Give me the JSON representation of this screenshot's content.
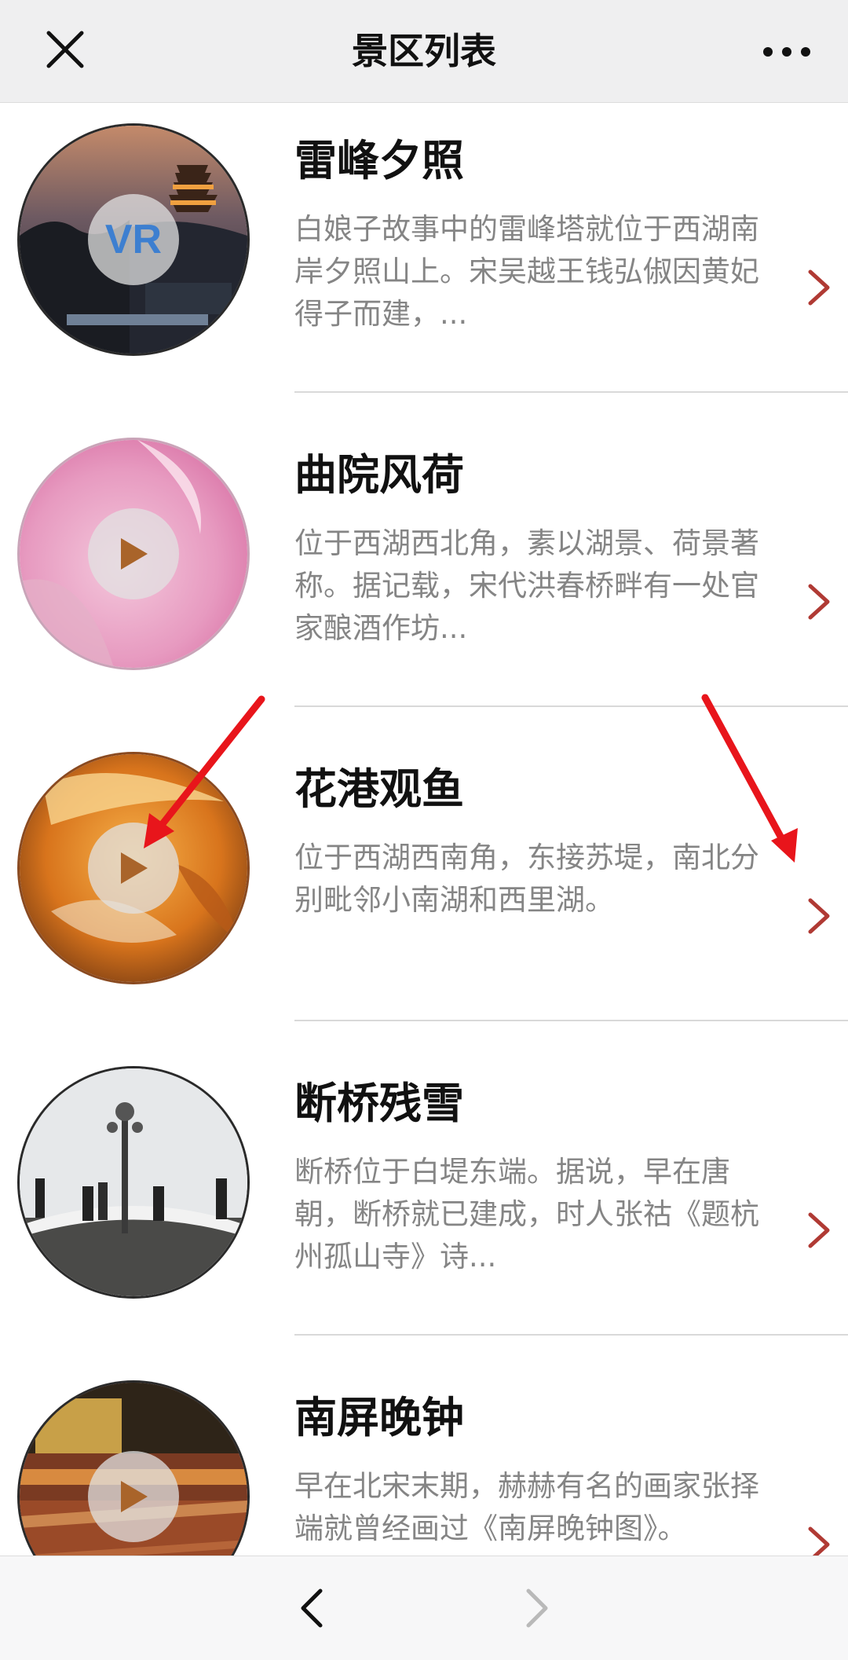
{
  "header": {
    "title": "景区列表",
    "close_icon": "close-icon",
    "more_icon": "more-dots-icon"
  },
  "spots": [
    {
      "name": "雷峰夕照",
      "desc": "白娘子故事中的雷峰塔就位于西湖南岸夕照山上。宋吴越王钱弘俶因黄妃得子而建，...",
      "badge": "VR"
    },
    {
      "name": "曲院风荷",
      "desc": "位于西湖西北角，素以湖景、荷景著称。据记载，宋代洪春桥畔有一处官家酿酒作坊...",
      "badge": "play-icon"
    },
    {
      "name": "花港观鱼",
      "desc": "位于西湖西南角，东接苏堤，南北分别毗邻小南湖和西里湖。",
      "badge": "play-icon"
    },
    {
      "name": "断桥残雪",
      "desc": "断桥位于白堤东端。据说，早在唐朝，断桥就已建成，时人张祜《题杭州孤山寺》诗...",
      "badge": "play-icon"
    },
    {
      "name": "南屏晚钟",
      "desc": "早在北宋末期，赫赫有名的画家张择端就曾经画过《南屏晚钟图》。",
      "badge": "play-icon"
    }
  ],
  "toolbar": {
    "back_icon": "chevron-left-icon",
    "forward_icon": "chevron-right-icon"
  },
  "colors": {
    "chevron": "#b03a34",
    "annotation_arrow": "#e8151b",
    "vr_text": "#3d7fd0",
    "play_triangle": "#a9642a"
  }
}
